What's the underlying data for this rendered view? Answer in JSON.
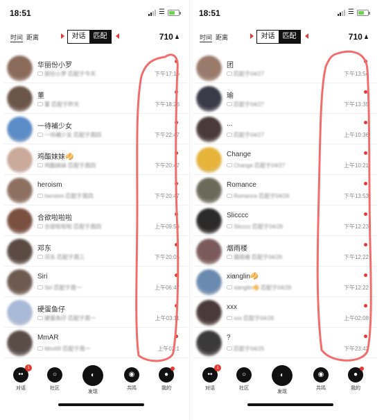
{
  "phones": [
    {
      "status_time": "18:51",
      "filter_tabs": [
        "时间",
        "距离"
      ],
      "segments": [
        "对话",
        "匹配"
      ],
      "count": "710",
      "rows": [
        {
          "name": "华丽份小罗",
          "sub": "丽份小罗 匹配于今天",
          "time": "下午17:16",
          "color": "#8a6a5a"
        },
        {
          "name": "董",
          "sub": "董 匹配于昨天",
          "time": "下午18:26",
          "color": "#6b5548"
        },
        {
          "name": "一待補少女",
          "sub": "一待補少女 匹配于周四",
          "time": "下午22:47",
          "color": "#5b8cc7"
        },
        {
          "name": "鸡酯妹妹🥠",
          "sub": "鸡酯妹妹 匹配于周四",
          "time": "下午20:47",
          "color": "#c9a99a"
        },
        {
          "name": "heroism",
          "sub": "heroism 匹配于周四",
          "time": "下午20:47",
          "color": "#8d7060"
        },
        {
          "name": "合欲啦啦啦",
          "sub": "合欲啦啦啦 匹配于周四",
          "time": "上午09:56",
          "color": "#7a5040"
        },
        {
          "name": "邓东",
          "sub": "邓东 匹配于周三",
          "time": "下午20:05",
          "color": "#5a4a42"
        },
        {
          "name": "Siri",
          "sub": "Siri 匹配于周一",
          "time": "上午06:47",
          "color": "#6e5a50"
        },
        {
          "name": "硬蛋鱼仔",
          "sub": "硬蛋鱼仔 匹配于周一",
          "time": "上午03:11",
          "color": "#a9b9d8"
        },
        {
          "name": "MmAR",
          "sub": "MmAR 匹配于周一",
          "time": "上午02:1",
          "color": "#5a4d48"
        }
      ],
      "nav": [
        {
          "label": "对话",
          "badge": "1"
        },
        {
          "label": "社区",
          "badge": ""
        },
        {
          "label": "发现",
          "badge": ""
        },
        {
          "label": "共鸣",
          "badge": ""
        },
        {
          "label": "我的",
          "badge": "•"
        }
      ]
    },
    {
      "status_time": "18:51",
      "filter_tabs": [
        "时间",
        "距离"
      ],
      "segments": [
        "对话",
        "匹配"
      ],
      "count": "710",
      "rows": [
        {
          "name": "团",
          "sub": "匹配于04/27",
          "time": "下午13:54",
          "color": "#9a7a6a"
        },
        {
          "name": "瑜",
          "sub": "匹配于04/27",
          "time": "下午13:35",
          "color": "#3a3a48"
        },
        {
          "name": "...",
          "sub": "匹配于04/27",
          "time": "上午10:36",
          "color": "#4a3a3a"
        },
        {
          "name": "Change",
          "sub": "Change 匹配于04/27",
          "time": "上午10:21",
          "color": "#e6b43a"
        },
        {
          "name": "Romance",
          "sub": "Romance 匹配于04/26",
          "time": "下午13:53",
          "color": "#6a6a5a"
        },
        {
          "name": "Slicccc",
          "sub": "Slicccc 匹配于04/26",
          "time": "下午12:23",
          "color": "#2a2a2a"
        },
        {
          "name": "烟雨楼",
          "sub": "烟雨楼 匹配于04/26",
          "time": "下午12:22",
          "color": "#7a5a5a"
        },
        {
          "name": "xianglin🥠",
          "sub": "xianglin🥠 匹配于04/26",
          "time": "下午12:22",
          "color": "#6a8ab0"
        },
        {
          "name": "xxx",
          "sub": "xxx 匹配于04/26",
          "time": "上午02:08",
          "color": "#4a3a3a"
        },
        {
          "name": "?",
          "sub": "匹配于04/25",
          "time": "下午23:43",
          "color": "#3a3a3a"
        }
      ],
      "nav": [
        {
          "label": "对话",
          "badge": "1"
        },
        {
          "label": "社区",
          "badge": ""
        },
        {
          "label": "发现",
          "badge": ""
        },
        {
          "label": "共鸣",
          "badge": ""
        },
        {
          "label": "我的",
          "badge": "•"
        }
      ]
    }
  ],
  "colors": {
    "accent": "#e53935",
    "ink": "#111111"
  },
  "icons": {
    "count": "people-icon",
    "wifi": "wifi-icon"
  }
}
